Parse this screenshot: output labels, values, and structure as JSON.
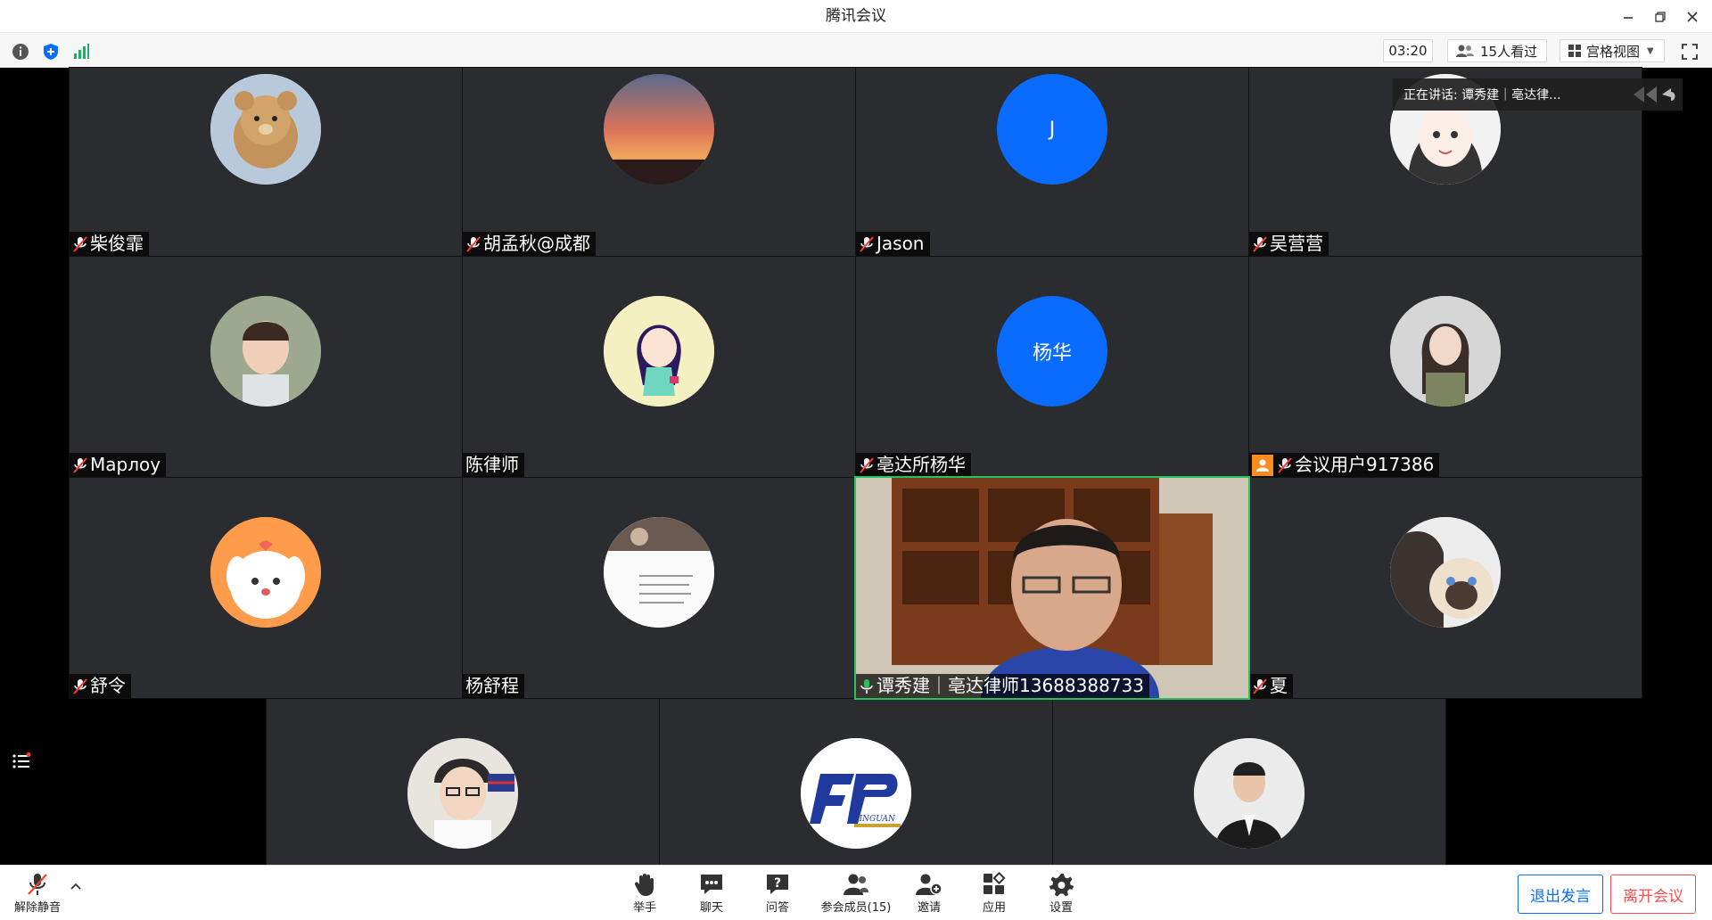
{
  "window": {
    "title": "腾讯会议"
  },
  "infobar": {
    "timer": "03:20",
    "viewers": "15人看过",
    "view_mode": "宫格视图"
  },
  "speaking": {
    "text": "正在讲话: 谭秀建｜亳达律..."
  },
  "participants": [
    {
      "name": "柴俊霏",
      "muted": true
    },
    {
      "name": "胡孟秋@成都",
      "muted": true
    },
    {
      "name": "Jason",
      "muted": true,
      "avatar_text": "J"
    },
    {
      "name": "吴营营",
      "muted": true
    },
    {
      "name": "Марлоу",
      "muted": true
    },
    {
      "name": "陈律师",
      "muted": false
    },
    {
      "name": "亳达所杨华",
      "muted": true,
      "avatar_text": "杨华"
    },
    {
      "name": "会议用户917386",
      "muted": true
    },
    {
      "name": "舒令",
      "muted": true
    },
    {
      "name": "杨舒程",
      "muted": false
    },
    {
      "name": "谭秀建｜亳达律师13688388733",
      "muted": false,
      "speaking": true
    },
    {
      "name": "夏",
      "muted": true
    }
  ],
  "bottom_row": [
    {
      "kind": "photo"
    },
    {
      "kind": "logo",
      "logo_text": "JINGUAN"
    },
    {
      "kind": "photo"
    }
  ],
  "toolbar": {
    "unmute": "解除静音",
    "raise_hand": "举手",
    "chat": "聊天",
    "qa": "问答",
    "members": "参会成员(15)",
    "invite": "邀请",
    "apps": "应用",
    "settings": "设置",
    "exit_speaking": "退出发言",
    "leave": "离开会议"
  },
  "colors": {
    "accent": "#0a6cff",
    "danger": "#ff4d4f",
    "speaking": "#27c25a",
    "tile_bg": "#2b2c30"
  }
}
